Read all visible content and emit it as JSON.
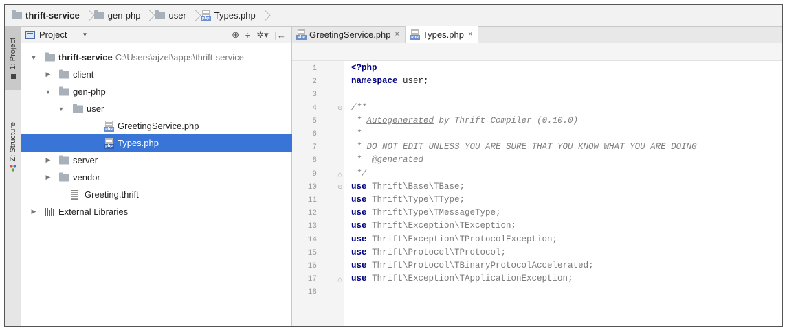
{
  "breadcrumb": {
    "items": [
      {
        "label": "thrift-service",
        "type": "folder",
        "bold": true
      },
      {
        "label": "gen-php",
        "type": "folder",
        "bold": false
      },
      {
        "label": "user",
        "type": "folder",
        "bold": false
      },
      {
        "label": "Types.php",
        "type": "php",
        "bold": false
      }
    ]
  },
  "toolstrip": {
    "project_tab": "1: Project",
    "structure_tab": "Z: Structure"
  },
  "project_panel": {
    "title": "Project",
    "tools": [
      "⊕",
      "÷",
      "✲▾",
      "|←"
    ],
    "tree": [
      {
        "label": "thrift-service",
        "path": "C:\\Users\\ajzel\\apps\\thrift-service",
        "icon": "folder-icon",
        "arrow": "▼",
        "depth": 0,
        "bold": true,
        "selected": false
      },
      {
        "label": "client",
        "icon": "folder-icon",
        "arrow": "▶",
        "depth": 1,
        "bold": false,
        "selected": false
      },
      {
        "label": "gen-php",
        "icon": "folder-icon",
        "arrow": "▼",
        "depth": 1,
        "bold": false,
        "selected": false
      },
      {
        "label": "user",
        "icon": "folder-icon",
        "arrow": "▼",
        "depth": 2,
        "bold": false,
        "selected": false
      },
      {
        "label": "GreetingService.php",
        "icon": "php-file-icon",
        "arrow": "",
        "depth": 3,
        "bold": false,
        "selected": false
      },
      {
        "label": "Types.php",
        "icon": "php-file-icon",
        "arrow": "",
        "depth": 3,
        "bold": false,
        "selected": true
      },
      {
        "label": "server",
        "icon": "folder-icon",
        "arrow": "▶",
        "depth": 1,
        "bold": false,
        "selected": false
      },
      {
        "label": "vendor",
        "icon": "folder-icon",
        "arrow": "▶",
        "depth": 1,
        "bold": false,
        "selected": false
      },
      {
        "label": "Greeting.thrift",
        "icon": "text-file-icon",
        "arrow": "",
        "depth": 2,
        "bold": false,
        "selected": false
      },
      {
        "label": "External Libraries",
        "icon": "libraries-icon",
        "arrow": "▶",
        "depth": 0,
        "bold": false,
        "selected": false
      }
    ]
  },
  "editor": {
    "tabs": [
      {
        "label": "GreetingService.php",
        "close": "×",
        "active": false
      },
      {
        "label": "Types.php",
        "close": "×",
        "active": true
      }
    ],
    "lines": [
      {
        "n": "1",
        "fold": "",
        "parts": [
          {
            "t": "<?php",
            "c": "kw"
          }
        ]
      },
      {
        "n": "2",
        "fold": "",
        "parts": [
          {
            "t": "namespace",
            "c": "kw"
          },
          {
            "t": " user;",
            "c": ""
          }
        ]
      },
      {
        "n": "3",
        "fold": "",
        "parts": []
      },
      {
        "n": "4",
        "fold": "⊖",
        "parts": [
          {
            "t": "/**",
            "c": "cm"
          }
        ]
      },
      {
        "n": "5",
        "fold": "",
        "parts": [
          {
            "t": " * ",
            "c": "cm"
          },
          {
            "t": "Autogenerated",
            "c": "cm cm-u"
          },
          {
            "t": " by Thrift Compiler (0.10.0)",
            "c": "cm"
          }
        ]
      },
      {
        "n": "6",
        "fold": "",
        "parts": [
          {
            "t": " *",
            "c": "cm"
          }
        ]
      },
      {
        "n": "7",
        "fold": "",
        "parts": [
          {
            "t": " * DO NOT EDIT UNLESS YOU ARE SURE THAT YOU KNOW WHAT YOU ARE DOING",
            "c": "cm"
          }
        ]
      },
      {
        "n": "8",
        "fold": "",
        "parts": [
          {
            "t": " *  ",
            "c": "cm"
          },
          {
            "t": "@generated",
            "c": "cm cm-u"
          }
        ]
      },
      {
        "n": "9",
        "fold": "△",
        "parts": [
          {
            "t": " */",
            "c": "cm"
          }
        ]
      },
      {
        "n": "10",
        "fold": "⊖",
        "parts": [
          {
            "t": "use",
            "c": "kw"
          },
          {
            "t": " Thrift\\Base\\TBase;",
            "c": "ns"
          }
        ]
      },
      {
        "n": "11",
        "fold": "",
        "parts": [
          {
            "t": "use",
            "c": "kw"
          },
          {
            "t": " Thrift\\Type\\TType;",
            "c": "ns"
          }
        ]
      },
      {
        "n": "12",
        "fold": "",
        "parts": [
          {
            "t": "use",
            "c": "kw"
          },
          {
            "t": " Thrift\\Type\\TMessageType;",
            "c": "ns"
          }
        ]
      },
      {
        "n": "13",
        "fold": "",
        "parts": [
          {
            "t": "use",
            "c": "kw"
          },
          {
            "t": " Thrift\\Exception\\TException;",
            "c": "ns"
          }
        ]
      },
      {
        "n": "14",
        "fold": "",
        "parts": [
          {
            "t": "use",
            "c": "kw"
          },
          {
            "t": " Thrift\\Exception\\TProtocolException;",
            "c": "ns"
          }
        ]
      },
      {
        "n": "15",
        "fold": "",
        "parts": [
          {
            "t": "use",
            "c": "kw"
          },
          {
            "t": " Thrift\\Protocol\\TProtocol;",
            "c": "ns"
          }
        ]
      },
      {
        "n": "16",
        "fold": "",
        "parts": [
          {
            "t": "use",
            "c": "kw"
          },
          {
            "t": " Thrift\\Protocol\\TBinaryProtocolAccelerated;",
            "c": "ns"
          }
        ]
      },
      {
        "n": "17",
        "fold": "△",
        "parts": [
          {
            "t": "use",
            "c": "kw"
          },
          {
            "t": " Thrift\\Exception\\TApplicationException;",
            "c": "ns"
          }
        ]
      },
      {
        "n": "18",
        "fold": "",
        "parts": []
      }
    ]
  },
  "colors": {
    "selection": "#3875d7",
    "keyword": "#000080",
    "comment": "#808080"
  }
}
